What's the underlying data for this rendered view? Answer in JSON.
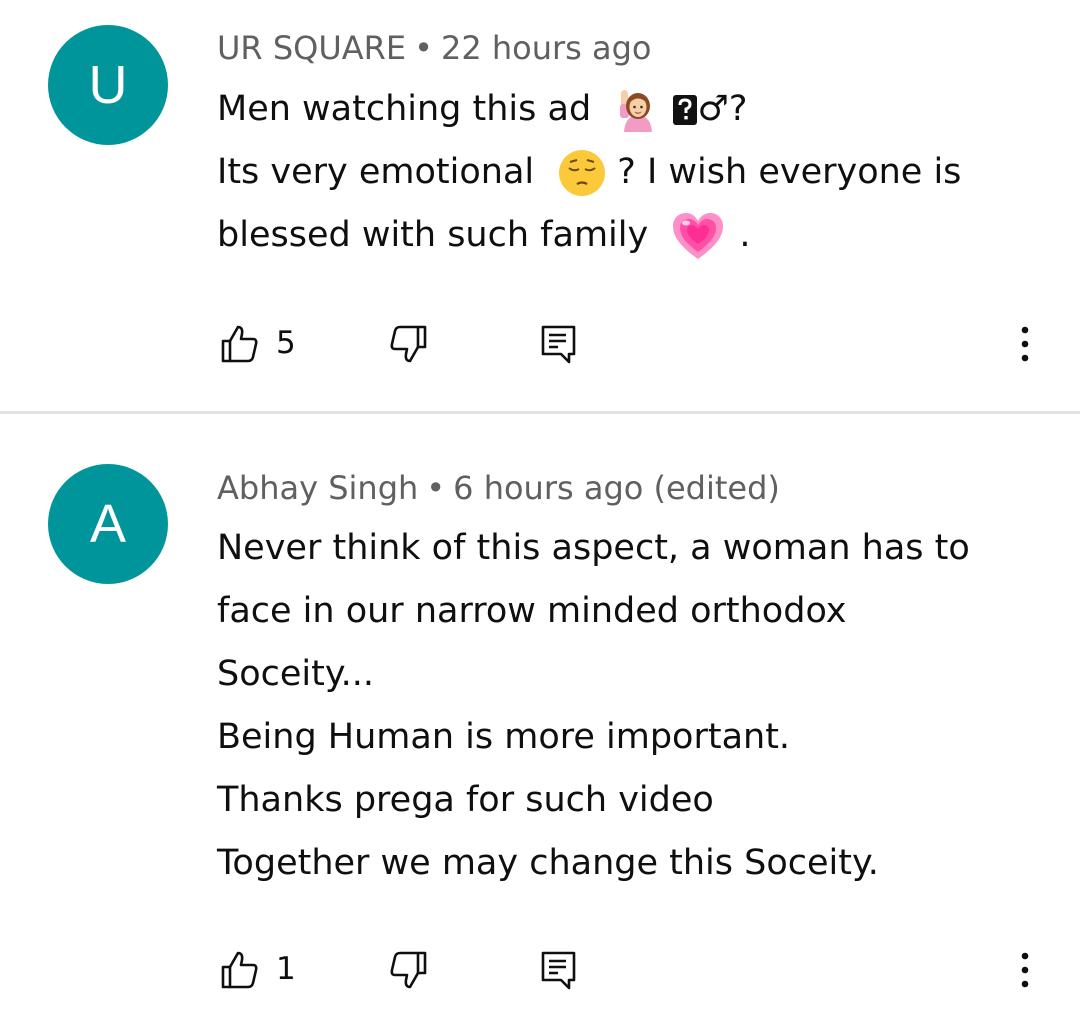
{
  "comments": [
    {
      "avatar_letter": "U",
      "author": "UR SQUARE",
      "separator": "•",
      "time": "22 hours ago",
      "edited": "",
      "lines": [
        "Men watching this ad",
        "Its very emotional",
        "? I wish everyone is",
        "blessed with such family",
        "."
      ],
      "inline_text": [
        "?"
      ],
      "emojis": [
        "raising-hand-woman-emoji",
        "replacement-glyph",
        "male-sign",
        "pensive-face-emoji",
        "growing-heart-emoji"
      ],
      "likes": "5"
    },
    {
      "avatar_letter": "A",
      "author": "Abhay Singh",
      "separator": "•",
      "time": "6 hours ago",
      "edited": "(edited)",
      "lines": [
        "Never think of this aspect, a woman has to",
        "face in our narrow minded orthodox",
        "Soceity...",
        "Being Human is more important.",
        "Thanks prega for such video",
        "Together we may change this Soceity."
      ],
      "likes": "1"
    }
  ],
  "icons": {
    "like": "thumbs-up-icon",
    "dislike": "thumbs-down-icon",
    "reply": "reply-comment-icon",
    "more": "more-vertical-icon"
  },
  "colors": {
    "avatar": "#00959b",
    "meta": "#606060",
    "text": "#0f0f0f",
    "divider": "#e3e3e3"
  }
}
